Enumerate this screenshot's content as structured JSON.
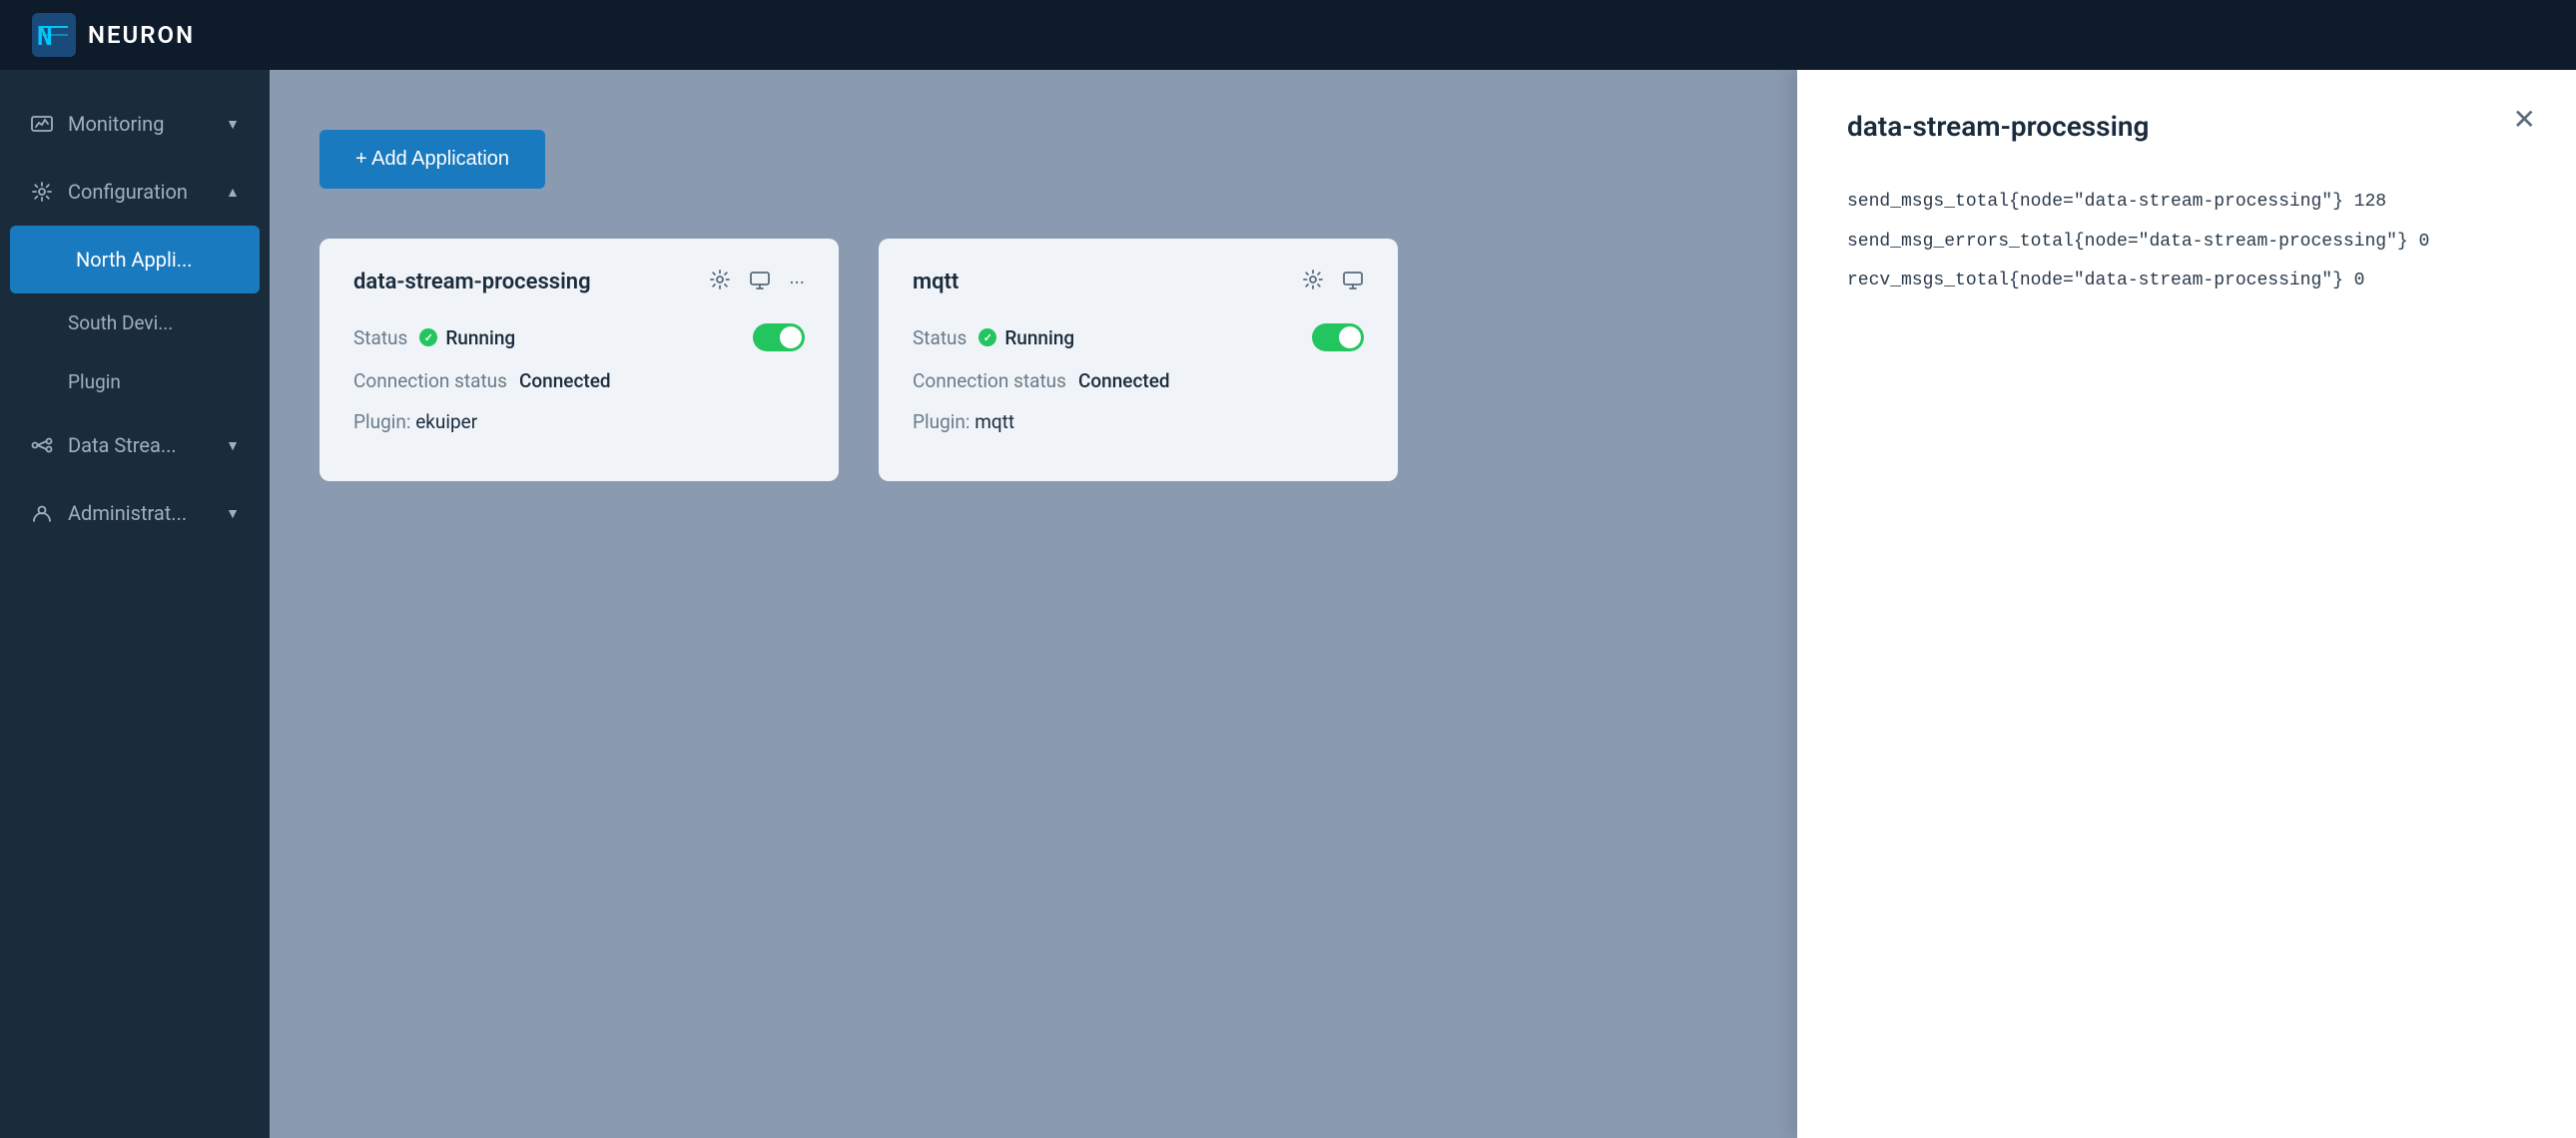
{
  "navbar": {
    "title": "NEURON"
  },
  "sidebar": {
    "items": [
      {
        "id": "monitoring",
        "label": "Monitoring",
        "icon": "chart",
        "expanded": false
      },
      {
        "id": "configuration",
        "label": "Configuration",
        "icon": "config",
        "expanded": true
      },
      {
        "id": "north-app",
        "label": "North Appli...",
        "icon": null,
        "active": true
      },
      {
        "id": "south-dev",
        "label": "South Devi...",
        "icon": null
      },
      {
        "id": "plugin",
        "label": "Plugin",
        "icon": null
      },
      {
        "id": "data-stream",
        "label": "Data Strea...",
        "icon": "stream",
        "expanded": false
      },
      {
        "id": "administration",
        "label": "Administrat...",
        "icon": "admin",
        "expanded": false
      }
    ]
  },
  "content": {
    "add_button_label": "+ Add Application",
    "cards": [
      {
        "id": "data-stream-processing",
        "title": "data-stream-processing",
        "status_label": "Status",
        "status_value": "Running",
        "connection_label": "Connection status",
        "connection_value": "Connected",
        "plugin_label": "Plugin:",
        "plugin_value": "ekuiper",
        "running": true
      },
      {
        "id": "mqtt",
        "title": "mqtt",
        "status_label": "Status",
        "status_value": "Running",
        "connection_label": "Connection status",
        "connection_value": "Connected",
        "plugin_label": "Plugin:",
        "plugin_value": "mqtt",
        "running": true
      }
    ]
  },
  "right_panel": {
    "title": "data-stream-processing",
    "stats": [
      "send_msgs_total{node=\"data-stream-processing\"} 128",
      "send_msg_errors_total{node=\"data-stream-processing\"} 0",
      "recv_msgs_total{node=\"data-stream-processing\"} 0"
    ]
  }
}
